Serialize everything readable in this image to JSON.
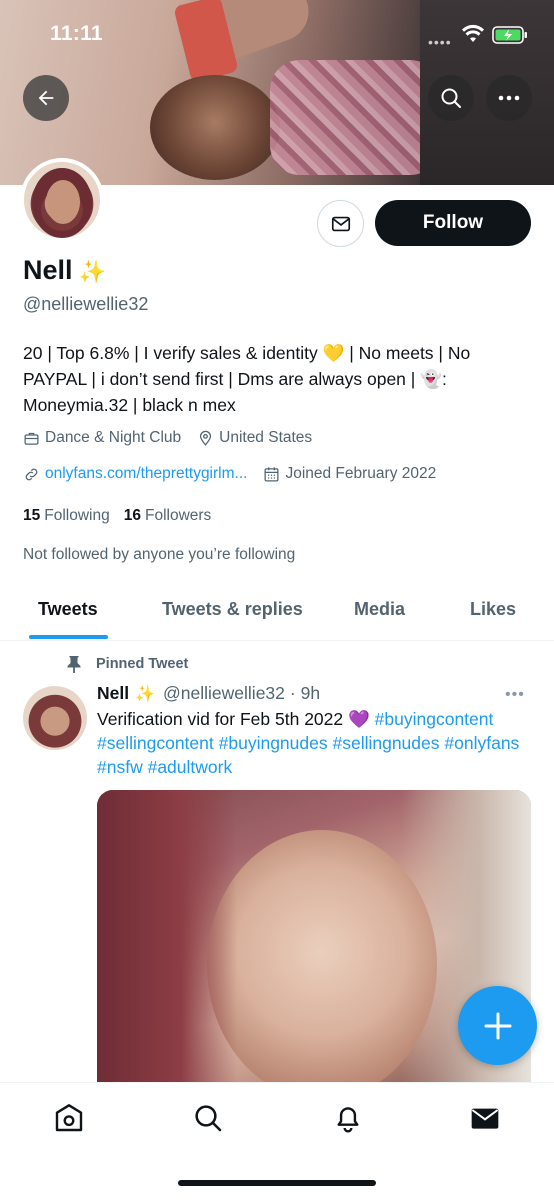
{
  "status_bar": {
    "time": "11:11"
  },
  "profile": {
    "name": "Nell",
    "name_emoji": "✨",
    "handle": "@nelliewellie32",
    "bio": "20 | Top 6.8% | I verify sales & identity 💛  | No meets | No PAYPAL | i don’t send first | Dms are always open | 👻: Moneymia.32 | black n mex",
    "category": "Dance & Night Club",
    "location": "United States",
    "website": "onlyfans.com/theprettygirlm...",
    "joined": "Joined February 2022",
    "following_count": "15",
    "following_label": "Following",
    "followers_count": "16",
    "followers_label": "Followers",
    "not_followed_text": "Not followed by anyone you’re following",
    "follow_button_label": "Follow"
  },
  "tabs": [
    {
      "label": "Tweets",
      "active": true
    },
    {
      "label": "Tweets & replies",
      "active": false
    },
    {
      "label": "Media",
      "active": false
    },
    {
      "label": "Likes",
      "active": false
    }
  ],
  "pinned_tweet": {
    "pinned_label": "Pinned Tweet",
    "author_name": "Nell",
    "author_emoji": "✨",
    "author_handle": "@nelliewellie32",
    "time": "· 9h",
    "more": "•••",
    "text_plain": "Verification vid for Feb 5th 2022 💜",
    "hashtags": [
      "#buyingcontent",
      "#sellingcontent",
      "#buyingnudes",
      "#sellingnudes",
      "#onlyfans",
      "#nsfw",
      "#adultwork"
    ]
  },
  "icons": {
    "back": "back-arrow-icon",
    "search": "search-icon",
    "more": "more-icon",
    "message": "envelope-icon",
    "briefcase": "briefcase-icon",
    "location": "location-pin-icon",
    "link": "link-icon",
    "calendar": "calendar-icon",
    "pin": "pin-icon",
    "compose": "plus-icon",
    "nav": [
      "home-icon",
      "search-icon",
      "bell-icon",
      "mail-icon"
    ]
  },
  "colors": {
    "accent": "#1d9bf0",
    "text": "#0f1419",
    "muted": "#536471"
  }
}
